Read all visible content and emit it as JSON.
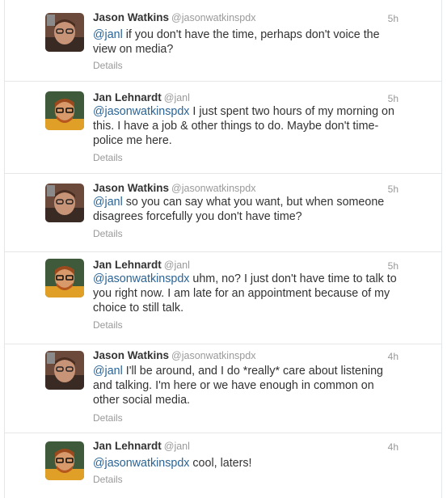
{
  "tweets": [
    {
      "author": "jason",
      "name": "Jason Watkins",
      "handle": "@jasonwatkinspdx",
      "time": "5h",
      "mention": "@janl",
      "text": " if you don't have the time, perhaps don't voice the view on media?",
      "details": "Details"
    },
    {
      "author": "jan",
      "name": "Jan Lehnardt",
      "handle": "@janl",
      "time": "5h",
      "mention": "@jasonwatkinspdx",
      "text": " I just spent two hours of my morning on this. I have a job & other things to do. Maybe don't time-police me here.",
      "details": "Details"
    },
    {
      "author": "jason",
      "name": "Jason Watkins",
      "handle": "@jasonwatkinspdx",
      "time": "5h",
      "mention": "@janl",
      "text": " so you can say what you want, but when someone disagrees forcefully you don't have time?",
      "details": "Details"
    },
    {
      "author": "jan",
      "name": "Jan Lehnardt",
      "handle": "@janl",
      "time": "5h",
      "mention": "@jasonwatkinspdx",
      "text": " uhm, no? I just don't have time to talk to you right now. I am late for an appointment because of my choice to still talk.",
      "details": "Details"
    },
    {
      "author": "jason",
      "name": "Jason Watkins",
      "handle": "@jasonwatkinspdx",
      "time": "4h",
      "mention": "@janl",
      "text": " I'll be around, and I do *really* care about listening and talking. I'm here or we have enough in common on other social media.",
      "details": "Details"
    },
    {
      "author": "jan",
      "name": "Jan Lehnardt",
      "handle": "@janl",
      "time": "4h",
      "mention": "@jasonwatkinspdx",
      "text": " cool, laters!",
      "details": "Details"
    }
  ]
}
